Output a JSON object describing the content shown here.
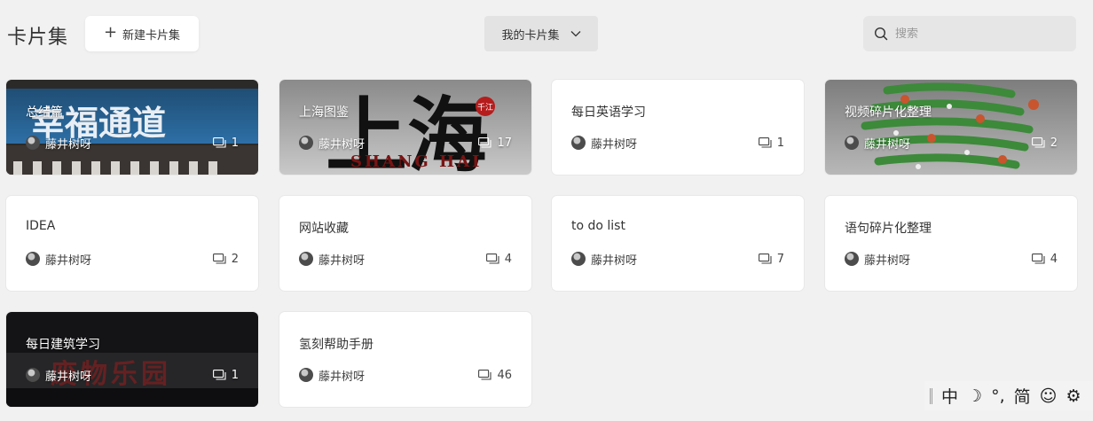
{
  "header": {
    "title": "卡片集",
    "new_button_label": "新建卡片集",
    "filter_label": "我的卡片集",
    "search_placeholder": "搜索"
  },
  "cards": [
    {
      "title": "总结篇",
      "author": "藤井树呀",
      "count": "1",
      "cover": "sign-blue",
      "cover_text": "幸福通道"
    },
    {
      "title": "上海图鉴",
      "author": "藤井树呀",
      "count": "17",
      "cover": "calligraphy",
      "cover_text": "上海",
      "cover_seal": "千江",
      "cover_roman": "SHANG HAI"
    },
    {
      "title": "每日英语学习",
      "author": "藤井树呀",
      "count": "1",
      "cover": null
    },
    {
      "title": "视频碎片化整理",
      "author": "藤井树呀",
      "count": "2",
      "cover": "tree"
    },
    {
      "title": "IDEA",
      "author": "藤井树呀",
      "count": "2",
      "cover": null
    },
    {
      "title": "网站收藏",
      "author": "藤井树呀",
      "count": "4",
      "cover": null
    },
    {
      "title": "to do list",
      "author": "藤井树呀",
      "count": "7",
      "cover": null
    },
    {
      "title": "语句碎片化整理",
      "author": "藤井树呀",
      "count": "4",
      "cover": null
    },
    {
      "title": "每日建筑学习",
      "author": "藤井树呀",
      "count": "1",
      "cover": "night-sign",
      "cover_text": "废物乐园"
    },
    {
      "title": "氢刻帮助手册",
      "author": "藤井树呀",
      "count": "46",
      "cover": null
    }
  ],
  "ime_toolbar": [
    "中",
    "☽",
    "°,",
    "简",
    "☺",
    "⚙"
  ]
}
